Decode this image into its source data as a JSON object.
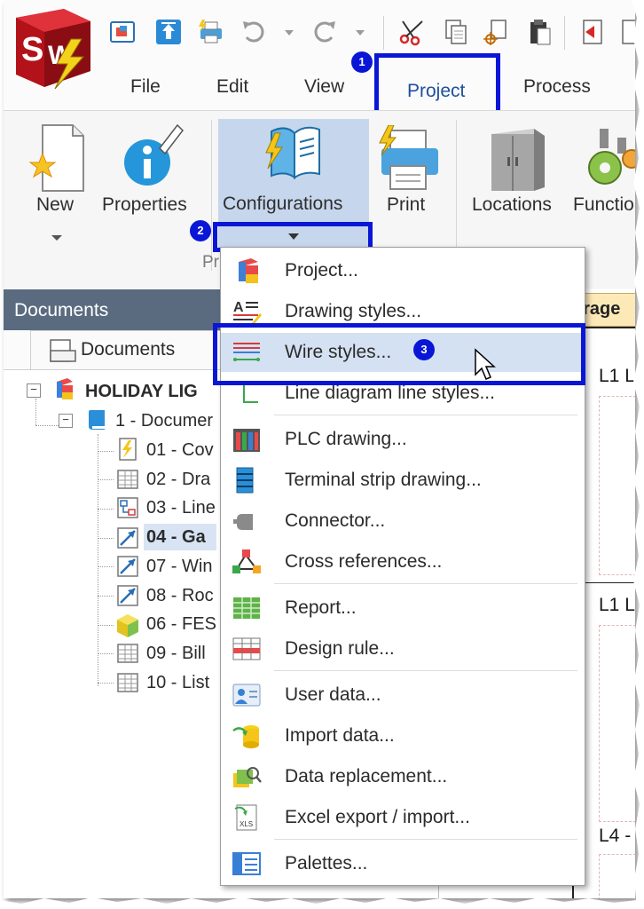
{
  "menu_tabs": [
    "File",
    "Edit",
    "View",
    "Project",
    "Process"
  ],
  "ribbon": {
    "new_label": "New",
    "properties_label": "Properties",
    "configurations_label": "Configurations",
    "print_label": "Print",
    "locations_label": "Locations",
    "functions_label": "Functio",
    "group_label": "Pr"
  },
  "badges": {
    "one": "1",
    "two": "2",
    "three": "3"
  },
  "documents": {
    "header": "Documents",
    "tab_label": "Documents",
    "tree": [
      {
        "label": "HOLIDAY LIG",
        "icon": "project-cube-icon",
        "bold": true
      },
      {
        "label": "1 - Documer",
        "icon": "book-icon",
        "bold": false
      },
      {
        "label": "01 - Cov",
        "icon": "cover-page-icon",
        "bold": false
      },
      {
        "label": "02 - Dra",
        "icon": "table-icon",
        "bold": false
      },
      {
        "label": "03 - Line",
        "icon": "line-diagram-icon",
        "bold": false
      },
      {
        "label": "04 - Ga",
        "icon": "scheme-icon",
        "bold": true
      },
      {
        "label": "07 - Win",
        "icon": "scheme-icon",
        "bold": false
      },
      {
        "label": "08 - Roc",
        "icon": "scheme-icon",
        "bold": false
      },
      {
        "label": "06 - FES",
        "icon": "3d-box-icon",
        "bold": false
      },
      {
        "label": "09 - Bill",
        "icon": "table-icon",
        "bold": false
      },
      {
        "label": "10 - List",
        "icon": "table-icon",
        "bold": false
      }
    ]
  },
  "drawing": {
    "tab_label": "arage",
    "labels": [
      "L1 L",
      "L1 L",
      "L4 -"
    ]
  },
  "dropdown_menu": [
    {
      "label": "Project...",
      "icon": "project-cube-icon"
    },
    {
      "label": "Drawing styles...",
      "icon": "drawing-styles-icon"
    },
    {
      "label": "Wire styles...",
      "icon": "wire-styles-icon"
    },
    {
      "label": "Line diagram line styles...",
      "icon": "line-style-icon"
    },
    {
      "label": "PLC drawing...",
      "icon": "plc-icon"
    },
    {
      "label": "Terminal strip drawing...",
      "icon": "terminal-strip-icon"
    },
    {
      "label": "Connector...",
      "icon": "connector-icon"
    },
    {
      "label": "Cross references...",
      "icon": "cross-references-icon"
    },
    {
      "label": "Report...",
      "icon": "report-icon"
    },
    {
      "label": "Design rule...",
      "icon": "design-rule-icon"
    },
    {
      "label": "User data...",
      "icon": "user-data-icon"
    },
    {
      "label": "Import data...",
      "icon": "import-data-icon"
    },
    {
      "label": "Data replacement...",
      "icon": "data-replacement-icon"
    },
    {
      "label": "Excel export / import...",
      "icon": "excel-icon"
    },
    {
      "label": "Palettes...",
      "icon": "palettes-icon"
    }
  ],
  "colors": {
    "highlight_box": "#0a16d6",
    "menu_hover": "#d4e1f2",
    "ribbon_active": "#c6d6ec",
    "docs_header": "#5a6b80"
  }
}
